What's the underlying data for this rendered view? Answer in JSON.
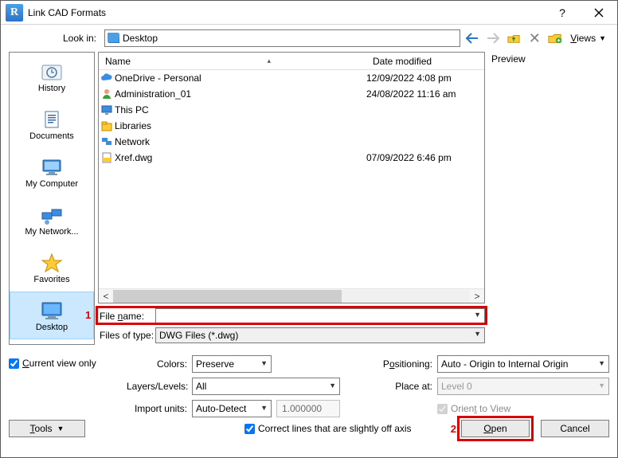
{
  "window": {
    "title": "Link CAD Formats"
  },
  "lookin": {
    "label": "Look in:",
    "value": "Desktop",
    "views_label": "Views"
  },
  "preview": {
    "label": "Preview"
  },
  "places": [
    {
      "name": "History"
    },
    {
      "name": "Documents"
    },
    {
      "name": "My Computer"
    },
    {
      "name": "My Network..."
    },
    {
      "name": "Favorites"
    },
    {
      "name": "Desktop"
    }
  ],
  "columns": {
    "name": "Name",
    "date": "Date modified"
  },
  "files": [
    {
      "name": "OneDrive - Personal",
      "date": "12/09/2022 4:08 pm",
      "icon": "cloud"
    },
    {
      "name": "Administration_01",
      "date": "24/08/2022 11:16 am",
      "icon": "user"
    },
    {
      "name": "This PC",
      "date": "",
      "icon": "pc"
    },
    {
      "name": "Libraries",
      "date": "",
      "icon": "lib"
    },
    {
      "name": "Network",
      "date": "",
      "icon": "net"
    },
    {
      "name": "Xref.dwg",
      "date": "07/09/2022 6:46 pm",
      "icon": "dwg"
    }
  ],
  "filefield": {
    "name_label": "File name:",
    "name_value": "",
    "type_label": "Files of type:",
    "type_value": "DWG Files  (*.dwg)"
  },
  "options": {
    "current_view_only": "Current view only",
    "colors_label": "Colors:",
    "colors_value": "Preserve",
    "layers_label": "Layers/Levels:",
    "layers_value": "All",
    "units_label": "Import units:",
    "units_value": "Auto-Detect",
    "units_scale": "1.000000",
    "positioning_label": "Positioning:",
    "positioning_value": "Auto - Origin to Internal Origin",
    "placeat_label": "Place at:",
    "placeat_value": "Level 0",
    "orient_label": "Orient to View",
    "correct_label": "Correct lines that are slightly off axis"
  },
  "buttons": {
    "tools": "Tools",
    "open": "Open",
    "cancel": "Cancel"
  },
  "annotations": {
    "one": "1",
    "two": "2"
  }
}
